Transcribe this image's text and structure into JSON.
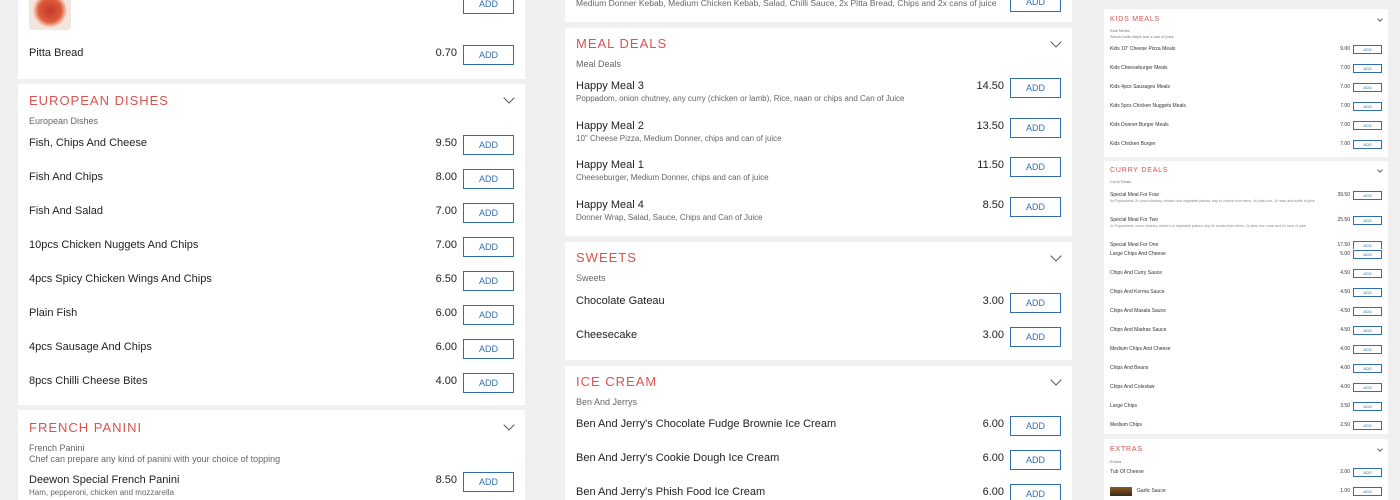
{
  "col1": {
    "top_item": {
      "name": "Pitta Bread",
      "price": "0.70"
    },
    "add_label": "ADD",
    "european": {
      "title": "European Dishes",
      "subtitle": "European Dishes",
      "items": [
        {
          "name": "Fish, Chips And Cheese",
          "price": "9.50"
        },
        {
          "name": "Fish And Chips",
          "price": "8.00"
        },
        {
          "name": "Fish And Salad",
          "price": "7.00"
        },
        {
          "name": "10pcs Chicken Nuggets And Chips",
          "price": "7.00"
        },
        {
          "name": "4pcs Spicy Chicken Wings And Chips",
          "price": "6.50"
        },
        {
          "name": "Plain Fish",
          "price": "6.00"
        },
        {
          "name": "4pcs Sausage And Chips",
          "price": "6.00"
        },
        {
          "name": "8pcs Chilli Cheese Bites",
          "price": "4.00"
        }
      ]
    },
    "panini": {
      "title": "French Panini",
      "subtitle": "French Panini",
      "description": "Chef can prepare any kind of panini with your choice of topping",
      "items": [
        {
          "name": "Deewon Special French Panini",
          "desc": "Ham, pepperoni, chicken and mozzarella",
          "price": "8.50"
        }
      ]
    }
  },
  "col2": {
    "top_desc": "Medium Donner Kebab, Medium Chicken Kebab, Salad, Chilli Sauce, 2x Pitta Bread, Chips and 2x cans of juice",
    "meal_deals": {
      "title": "Meal Deals",
      "subtitle": "Meal Deals",
      "items": [
        {
          "name": "Happy Meal 3",
          "desc": "Poppadom, onion chutney, any curry (chicken or lamb), Rice, naan or chips and Can of Juice",
          "price": "14.50"
        },
        {
          "name": "Happy Meal 2",
          "desc": "10\" Cheese Pizza, Medium Donner, chips and can of juice",
          "price": "13.50"
        },
        {
          "name": "Happy Meal 1",
          "desc": "Cheeseburger, Medium Donner, chips and can of juice",
          "price": "11.50"
        },
        {
          "name": "Happy Meal 4",
          "desc": "Donner Wrap, Salad, Sauce, Chips and Can of Juice",
          "price": "8.50"
        }
      ]
    },
    "sweets": {
      "title": "Sweets",
      "subtitle": "Sweets",
      "items": [
        {
          "name": "Chocolate Gateau",
          "price": "3.00"
        },
        {
          "name": "Cheesecake",
          "price": "3.00"
        }
      ]
    },
    "ice_cream": {
      "title": "Ice Cream",
      "subtitle": "Ben And Jerrys",
      "items": [
        {
          "name": "Ben And Jerry's Chocolate Fudge Brownie Ice Cream",
          "price": "6.00"
        },
        {
          "name": "Ben And Jerry's Cookie Dough Ice Cream",
          "price": "6.00"
        },
        {
          "name": "Ben And Jerry's Phish Food Ice Cream",
          "price": "6.00"
        }
      ]
    }
  },
  "col3": {
    "kids": {
      "title": "Kids Meals",
      "subtitle": "Kids Meals",
      "note": "Served with chips and a can of juice",
      "items": [
        {
          "name": "Kids 10\" Cheese Pizza Meals",
          "price": "9.00"
        },
        {
          "name": "Kids Cheeseburger Meals",
          "price": "7.00"
        },
        {
          "name": "Kids 4pcs Sausages Meals",
          "price": "7.00"
        },
        {
          "name": "Kids 5pcs Chicken Nuggets Meals",
          "price": "7.00"
        },
        {
          "name": "Kids Donner Burger Meals",
          "price": "7.00"
        },
        {
          "name": "Kids Chicken Burger",
          "price": "7.00"
        }
      ]
    },
    "curry": {
      "title": "Curry Deals",
      "subtitle": "Curry Deals",
      "items": [
        {
          "name": "Special Meal For Four",
          "desc": "4x Poppadoms, 2x onion chutney, chicken and vegetable pakora, any 4x curries from menu, 4x pilau rice, 2x naan and bottle of juice",
          "price": "39.50"
        },
        {
          "name": "Special Meal For Two",
          "desc": "2x Poppadoms, onion chutney, chicken or vegetable pakora, any 2x curries from menu, 2x pilau rice, naan and 2x cans of juice",
          "price": "25.50"
        },
        {
          "name": "Special Meal For One",
          "price": "17.50"
        }
      ]
    },
    "chips": {
      "items": [
        {
          "name": "Large Chips And Cheese",
          "price": "5.00"
        },
        {
          "name": "Chips And Curry Sauce",
          "price": "4.50"
        },
        {
          "name": "Chips And Korma Sauce",
          "price": "4.50"
        },
        {
          "name": "Chips And Masala Sauce",
          "price": "4.50"
        },
        {
          "name": "Chips And Madras Sauce",
          "price": "4.50"
        },
        {
          "name": "Medium Chips And Cheese",
          "price": "4.00"
        },
        {
          "name": "Chips And Beans",
          "price": "4.00"
        },
        {
          "name": "Chips And Coleslaw",
          "price": "4.00"
        },
        {
          "name": "Large Chips",
          "price": "3.50"
        },
        {
          "name": "Medium Chips",
          "price": "2.50"
        }
      ]
    },
    "extras": {
      "title": "Extras",
      "subtitle": "Extras",
      "items": [
        {
          "name": "Tub Of Cheese",
          "price": "2.00"
        },
        {
          "name": "Garlic Sauce",
          "price": "1.00"
        }
      ]
    }
  }
}
